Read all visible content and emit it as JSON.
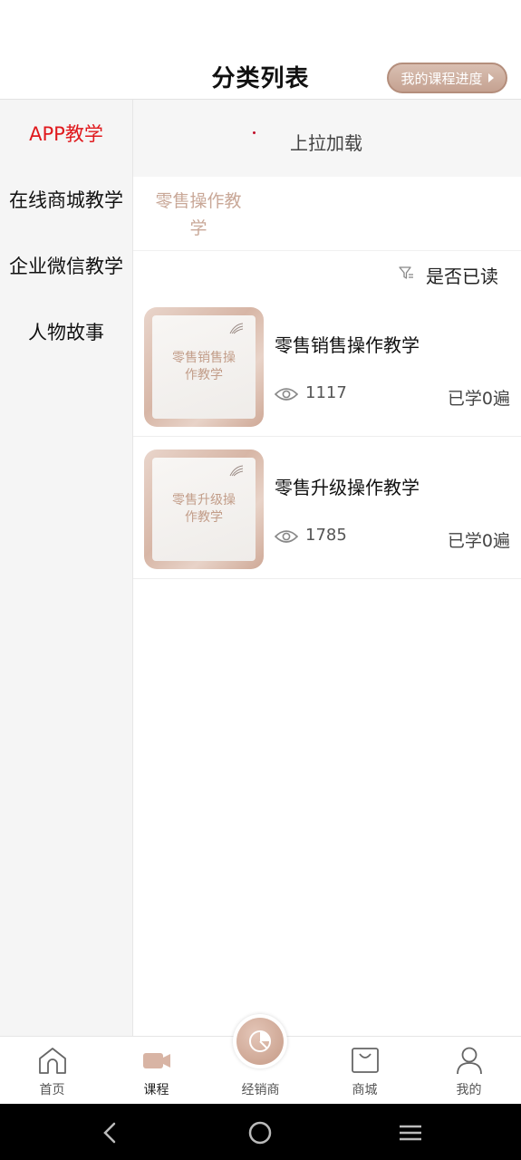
{
  "header": {
    "title": "分类列表",
    "progress_button": "我的课程进度"
  },
  "sidebar": {
    "items": [
      {
        "label": "APP教学",
        "active": true
      },
      {
        "label": "在线商城教学",
        "active": false
      },
      {
        "label": "企业微信教学",
        "active": false
      },
      {
        "label": "人物故事",
        "active": false
      }
    ]
  },
  "main": {
    "pull_load_text": "上拉加载",
    "sub_tab": "零售操作教学",
    "filter_label": "是否已读",
    "courses": [
      {
        "thumb_text": "零售销售操作教学",
        "title": "零售销售操作教学",
        "views": "1117",
        "learned": "已学0遍"
      },
      {
        "thumb_text": "零售升级操作教学",
        "title": "零售升级操作教学",
        "views": "1785",
        "learned": "已学0遍"
      }
    ]
  },
  "bottom_nav": {
    "items": [
      {
        "label": "首页",
        "icon": "home-icon"
      },
      {
        "label": "课程",
        "icon": "video-icon"
      },
      {
        "label": "经销商",
        "icon": "pie-chart-icon"
      },
      {
        "label": "商城",
        "icon": "shopping-bag-icon"
      },
      {
        "label": "我的",
        "icon": "user-icon"
      }
    ]
  },
  "colors": {
    "accent_red": "#e0191d",
    "brand_rose": "#c9a898",
    "active_tab_icon": "#d8b4a4"
  }
}
